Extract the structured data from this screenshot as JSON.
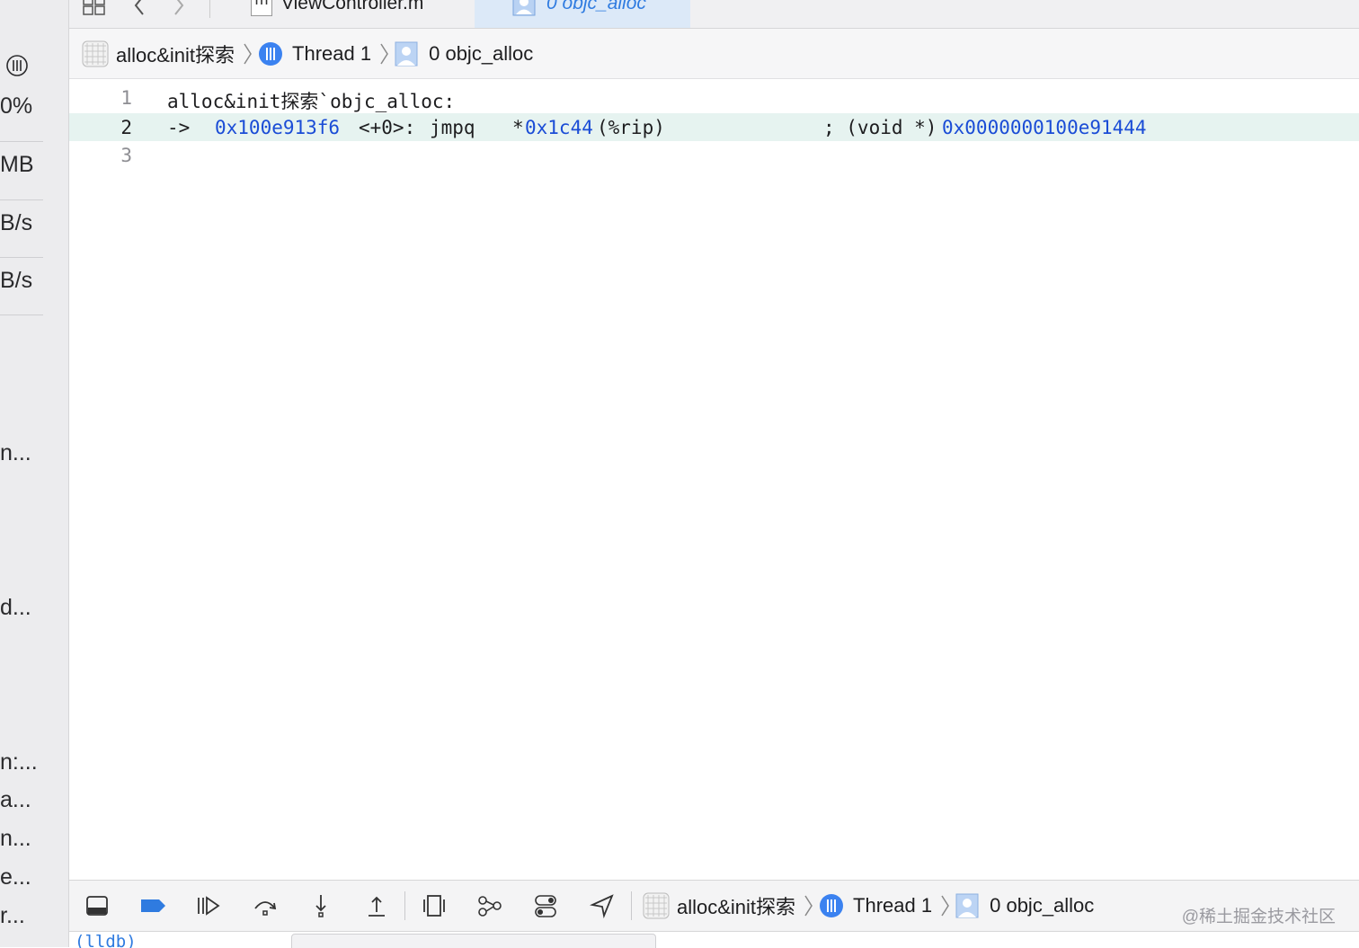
{
  "left_panel": {
    "gauges": [
      "0%",
      "MB",
      "B/s",
      "B/s"
    ],
    "items": [
      "n...",
      "d...",
      "n:...",
      "a...",
      "n...",
      "e...",
      "r..."
    ]
  },
  "tab_bar": {
    "tabs": [
      {
        "label": "ViewController.m",
        "icon": "m"
      },
      {
        "label": "0 objc_alloc"
      }
    ]
  },
  "jump_bar": {
    "app": "alloc&init探索",
    "thread": "Thread 1",
    "frame": "0 objc_alloc"
  },
  "editor": {
    "lines": [
      {
        "number": "1",
        "text": "alloc&init探索`objc_alloc:"
      },
      {
        "number": "2",
        "arrow": "->",
        "address": "0x100e913f6",
        "offset": "<+0>:",
        "mnemonic": "jmpq",
        "operand_prefix": "*",
        "operand_addr": "0x1c44",
        "operand_suffix": "(%rip)",
        "comment_prefix": "; (void *)",
        "comment_addr": "0x0000000100e91444"
      },
      {
        "number": "3",
        "text": ""
      }
    ]
  },
  "debug_bar": {
    "app": "alloc&init探索",
    "thread": "Thread 1",
    "frame": "0 objc_alloc"
  },
  "watermark": "@稀土掘金技术社区",
  "console": {
    "prompt": "(lldb)"
  },
  "colors": {
    "accent": "#2f7be0",
    "current_line": "#e6f3f0",
    "address": "#1a4cd6"
  }
}
